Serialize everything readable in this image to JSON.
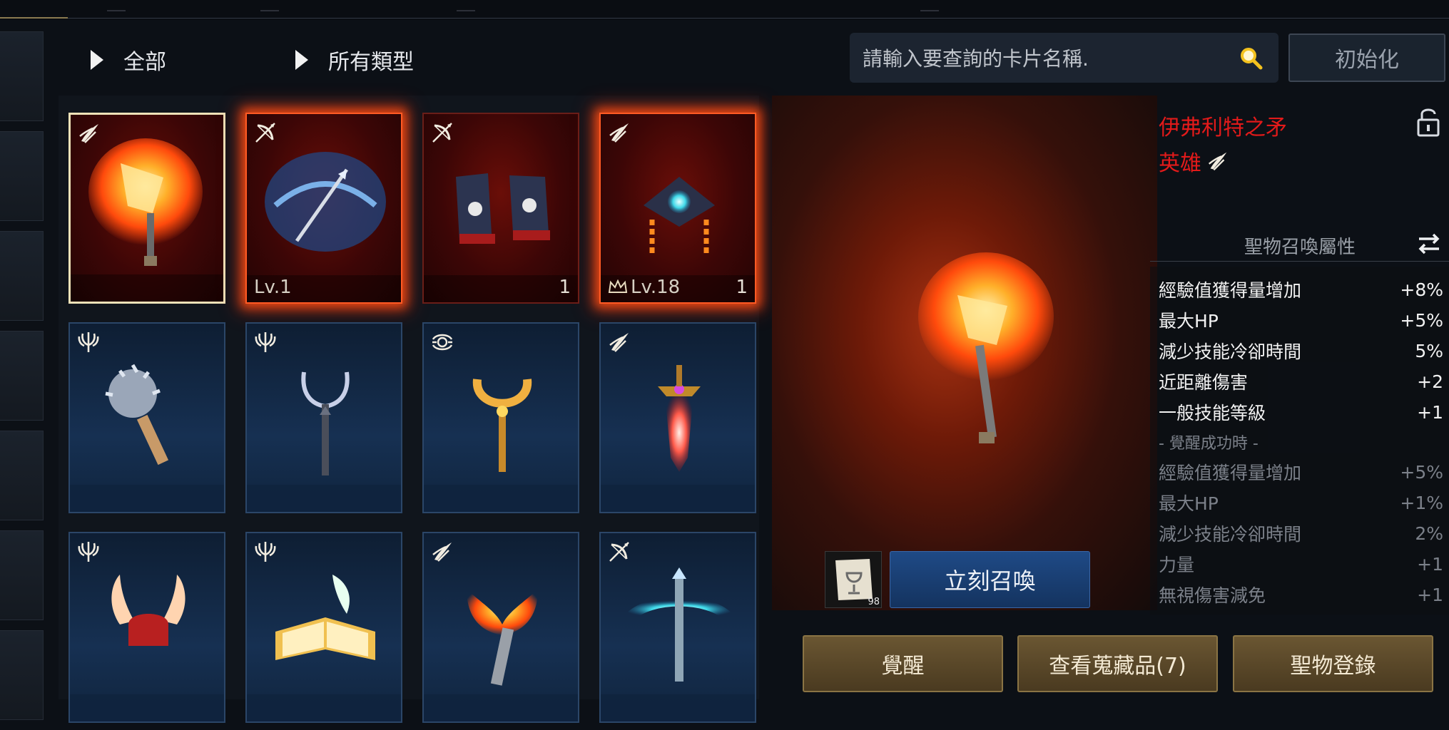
{
  "filters": {
    "rarity": "全部",
    "type": "所有類型"
  },
  "search": {
    "placeholder": "請輸入要查詢的卡片名稱."
  },
  "reset_label": "初始化",
  "cards": [
    {
      "class_icon": "blade-icon",
      "count": "",
      "level": "",
      "crown": false
    },
    {
      "class_icon": "bow-icon",
      "count": "",
      "level": "Lv.1",
      "crown": false
    },
    {
      "class_icon": "bow-icon",
      "count": "1",
      "level": "",
      "crown": false
    },
    {
      "class_icon": "blade-icon",
      "count": "1",
      "level": "Lv.18",
      "crown": true
    },
    {
      "class_icon": "trident-icon",
      "count": "",
      "level": "",
      "crown": false
    },
    {
      "class_icon": "trident-icon",
      "count": "",
      "level": "",
      "crown": false
    },
    {
      "class_icon": "orb-icon",
      "count": "",
      "level": "",
      "crown": false
    },
    {
      "class_icon": "blade-icon",
      "count": "",
      "level": "",
      "crown": false
    },
    {
      "class_icon": "trident-icon",
      "count": "",
      "level": "",
      "crown": false
    },
    {
      "class_icon": "trident-icon",
      "count": "",
      "level": "",
      "crown": false
    },
    {
      "class_icon": "blade-icon",
      "count": "",
      "level": "",
      "crown": false
    },
    {
      "class_icon": "bow-icon",
      "count": "",
      "level": "",
      "crown": false
    }
  ],
  "detail": {
    "name": "伊弗利特之矛",
    "rarity": "英雄",
    "attr_header": "聖物召喚屬性",
    "stats": [
      {
        "label": "經驗值獲得量增加",
        "value": "+8%"
      },
      {
        "label": "最大HP",
        "value": "+5%"
      },
      {
        "label": "減少技能冷卻時間",
        "value": "5%"
      },
      {
        "label": "近距離傷害",
        "value": "+2"
      },
      {
        "label": "一般技能等級",
        "value": "+1"
      }
    ],
    "awaken_note": "- 覺醒成功時 -",
    "awaken_stats": [
      {
        "label": "經驗值獲得量增加",
        "value": "+5%"
      },
      {
        "label": "最大HP",
        "value": "+1%"
      },
      {
        "label": "減少技能冷卻時間",
        "value": "2%"
      },
      {
        "label": "力量",
        "value": "+1"
      },
      {
        "label": "無視傷害減免",
        "value": "+1"
      }
    ]
  },
  "summon": {
    "item_count": "98",
    "label": "立刻召喚"
  },
  "buttons": {
    "awaken": "覺醒",
    "collection": "查看蒐藏品(7)",
    "register": "聖物登錄"
  },
  "colors": {
    "rarity_red": "#e21a1a",
    "gold_button": "#6a5632",
    "summon_blue": "#1f4a86"
  }
}
